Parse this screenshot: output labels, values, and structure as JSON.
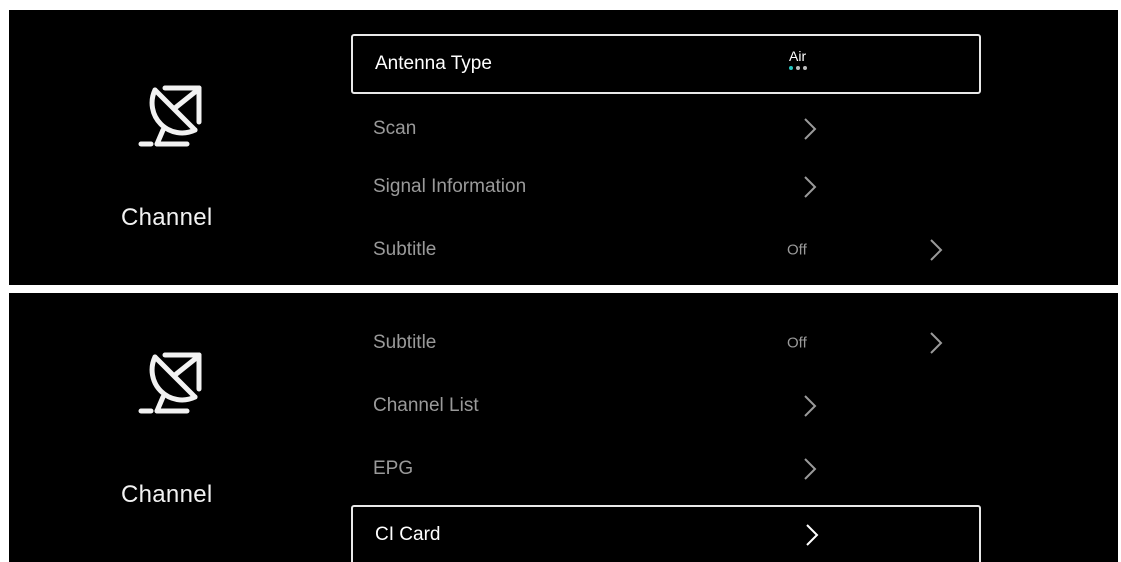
{
  "colors": {
    "background": "#000000",
    "text_active": "#ffffff",
    "text_inactive": "#9a9a9a",
    "focus_border": "#e8e8e8",
    "indicator_active": "#27c6c0",
    "indicator_inactive": "#bdbdbd"
  },
  "category": {
    "icon": "satellite-dish-icon",
    "label": "Channel"
  },
  "top_menu": {
    "antenna_type": {
      "label": "Antenna Type",
      "value": "Air",
      "option_count": 3,
      "selected_index": 0
    },
    "scan": {
      "label": "Scan"
    },
    "signal_information": {
      "label": "Signal Information"
    },
    "subtitle": {
      "label": "Subtitle",
      "value": "Off"
    }
  },
  "bottom_menu": {
    "subtitle": {
      "label": "Subtitle",
      "value": "Off"
    },
    "channel_list": {
      "label": "Channel List"
    },
    "epg": {
      "label": "EPG"
    },
    "ci_card": {
      "label": "CI Card"
    }
  }
}
